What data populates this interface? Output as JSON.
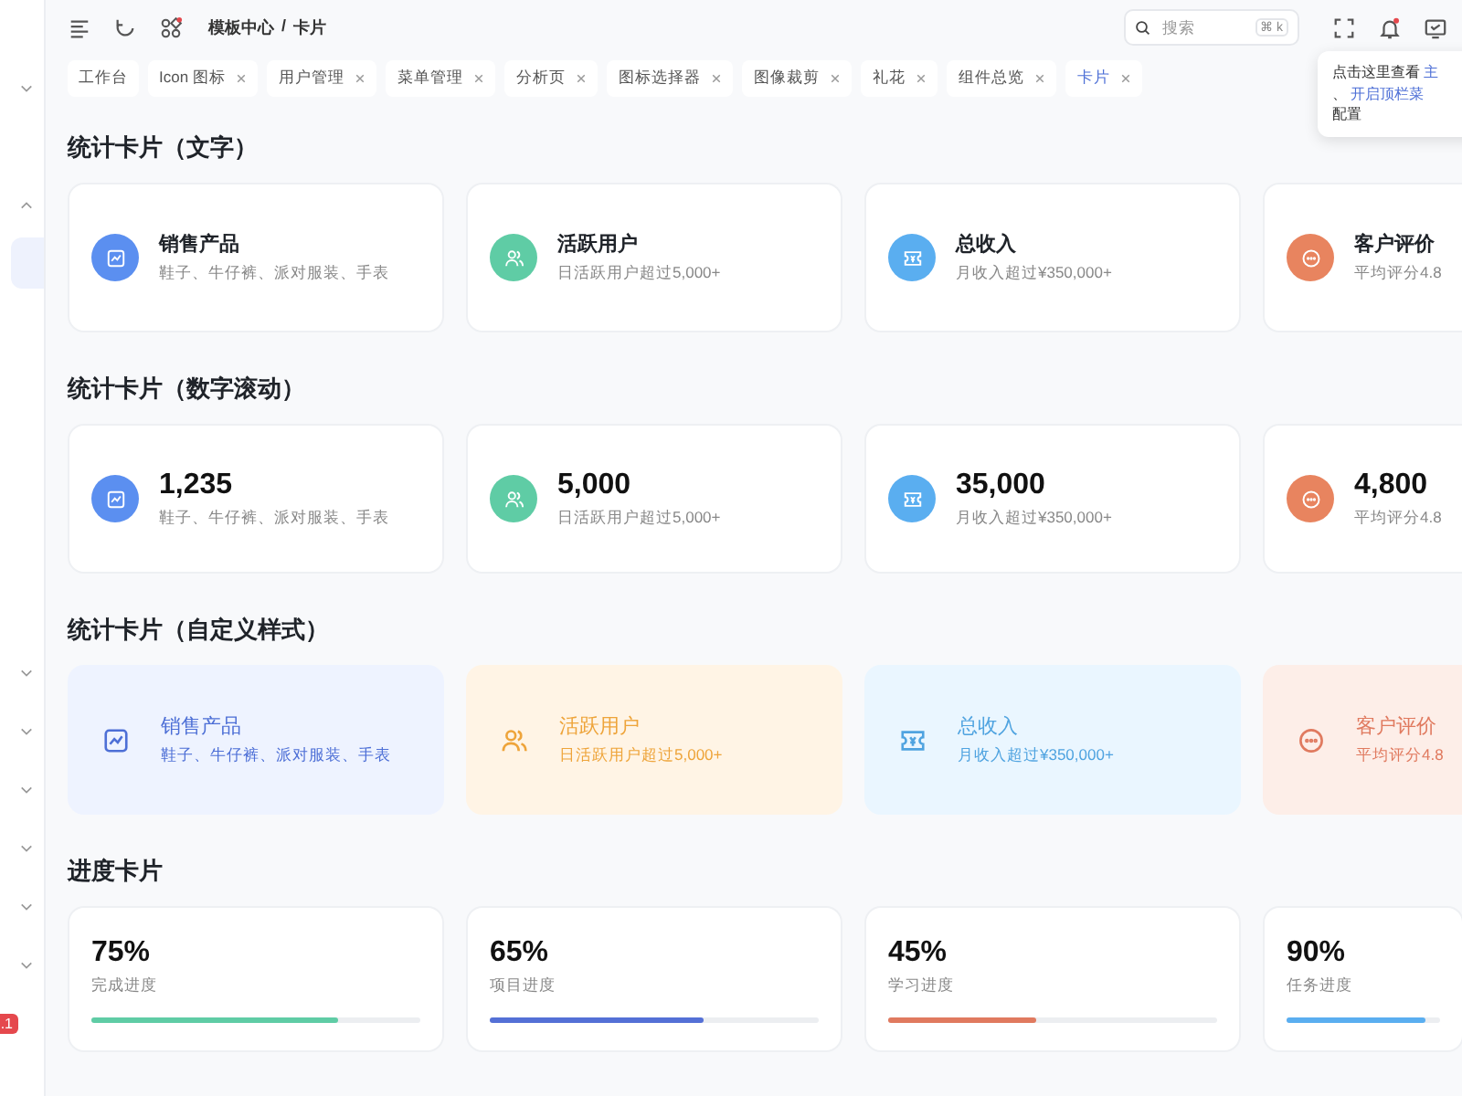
{
  "sidebar": {
    "badge": ".1"
  },
  "header": {
    "breadcrumb": [
      "模板中心",
      "卡片"
    ],
    "breadcrumb_separator": "/",
    "search": {
      "placeholder": "搜索",
      "shortcut": "⌘ k"
    }
  },
  "tabs": [
    {
      "label": "工作台",
      "closable": false,
      "selected": false
    },
    {
      "label": "Icon 图标",
      "closable": true,
      "selected": false
    },
    {
      "label": "用户管理",
      "closable": true,
      "selected": false
    },
    {
      "label": "菜单管理",
      "closable": true,
      "selected": false
    },
    {
      "label": "分析页",
      "closable": true,
      "selected": false
    },
    {
      "label": "图标选择器",
      "closable": true,
      "selected": false
    },
    {
      "label": "图像裁剪",
      "closable": true,
      "selected": false
    },
    {
      "label": "礼花",
      "closable": true,
      "selected": false
    },
    {
      "label": "组件总览",
      "closable": true,
      "selected": false
    },
    {
      "label": "卡片",
      "closable": true,
      "selected": true
    }
  ],
  "tip": {
    "text": "点击这里查看",
    "link": "主",
    "separator": "、",
    "link_2": "开启顶栏菜",
    "text_2": "配置"
  },
  "sections": [
    {
      "title": "统计卡片（文字）",
      "kind": "stat",
      "cards": [
        {
          "kind": "chart",
          "color": "#5b8ff0",
          "title": "销售产品",
          "subtitle": "鞋子、牛仔裤、派对服装、手表"
        },
        {
          "kind": "users",
          "color": "#5fcca5",
          "title": "活跃用户",
          "subtitle": "日活跃用户超过5,000+"
        },
        {
          "kind": "ticket",
          "color": "#5aaef0",
          "title": "总收入",
          "subtitle": "月收入超过¥350,000+"
        },
        {
          "kind": "more",
          "color": "#e8845f",
          "title": "客户评价",
          "subtitle": "平均评分4.8"
        }
      ]
    },
    {
      "title": "统计卡片（数字滚动）",
      "kind": "number",
      "cards": [
        {
          "kind": "chart",
          "color": "#5b8ff0",
          "title": "1,235",
          "subtitle": "鞋子、牛仔裤、派对服装、手表"
        },
        {
          "kind": "users",
          "color": "#5fcca5",
          "title": "5,000",
          "subtitle": "日活跃用户超过5,000+"
        },
        {
          "kind": "ticket",
          "color": "#5aaef0",
          "title": "35,000",
          "subtitle": "月收入超过¥350,000+"
        },
        {
          "kind": "more",
          "color": "#e8845f",
          "title": "4,800",
          "subtitle": "平均评分4.8"
        }
      ]
    },
    {
      "title": "统计卡片（自定义样式）",
      "kind": "custom",
      "cards": [
        {
          "kind": "chart",
          "color": "#4d6fd6",
          "title": "销售产品",
          "subtitle": "鞋子、牛仔裤、派对服装、手表"
        },
        {
          "kind": "users",
          "color": "#eea43a",
          "title": "活跃用户",
          "subtitle": "日活跃用户超过5,000+"
        },
        {
          "kind": "ticket",
          "color": "#4fa3e0",
          "title": "总收入",
          "subtitle": "月收入超过¥350,000+"
        },
        {
          "kind": "more",
          "color": "#e07a5f",
          "title": "客户评价",
          "subtitle": "平均评分4.8"
        }
      ]
    },
    {
      "title": "进度卡片",
      "kind": "progress",
      "cards": [
        {
          "value": "75%",
          "label": "完成进度",
          "level": 0.75,
          "color": "#5fcca5"
        },
        {
          "value": "65%",
          "label": "项目进度",
          "level": 0.65,
          "color": "#5470d6"
        },
        {
          "value": "45%",
          "label": "学习进度",
          "level": 0.45,
          "color": "#e07a5f"
        },
        {
          "value": "90%",
          "label": "任务进度",
          "level": 0.9,
          "color": "#5aaef0"
        }
      ]
    }
  ]
}
